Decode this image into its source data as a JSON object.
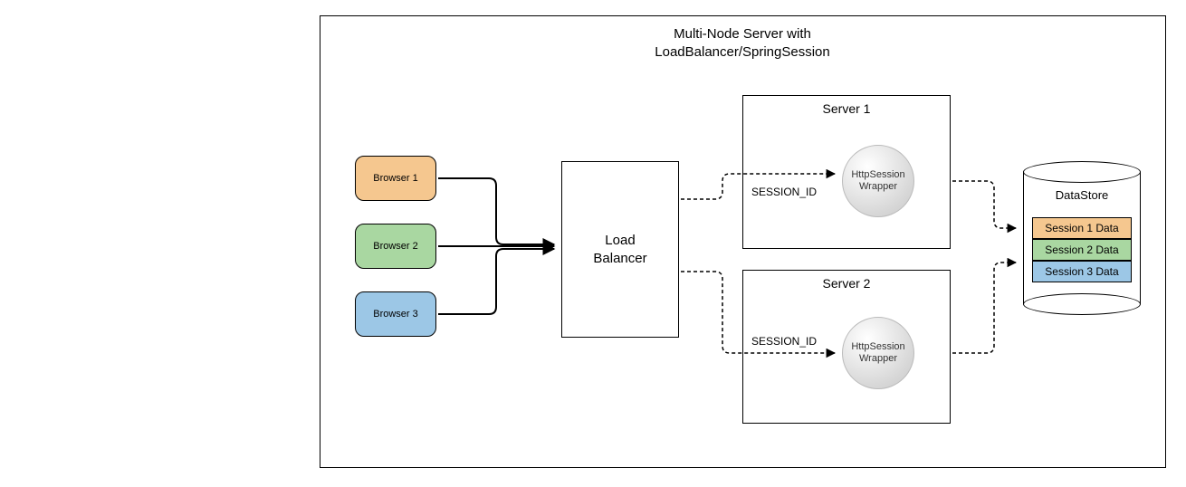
{
  "title": "Multi-Node Server with\nLoadBalancer/SpringSession",
  "browsers": [
    {
      "label": "Browser 1",
      "fill": "#f5c78f"
    },
    {
      "label": "Browser 2",
      "fill": "#a9d7a1"
    },
    {
      "label": "Browser 3",
      "fill": "#9cc7e6"
    }
  ],
  "balancer": "Load\nBalancer",
  "servers": [
    {
      "title": "Server 1",
      "session_label": "SESSION_ID",
      "wrapper": "HttpSession\nWrapper"
    },
    {
      "title": "Server 2",
      "session_label": "SESSION_ID",
      "wrapper": "HttpSession\nWrapper"
    }
  ],
  "datastore": {
    "title": "DataStore",
    "rows": [
      {
        "label": "Session 1 Data",
        "fill": "#f5c78f"
      },
      {
        "label": "Session 2 Data",
        "fill": "#a9d7a1"
      },
      {
        "label": "Session 3 Data",
        "fill": "#9cc7e6"
      }
    ]
  }
}
